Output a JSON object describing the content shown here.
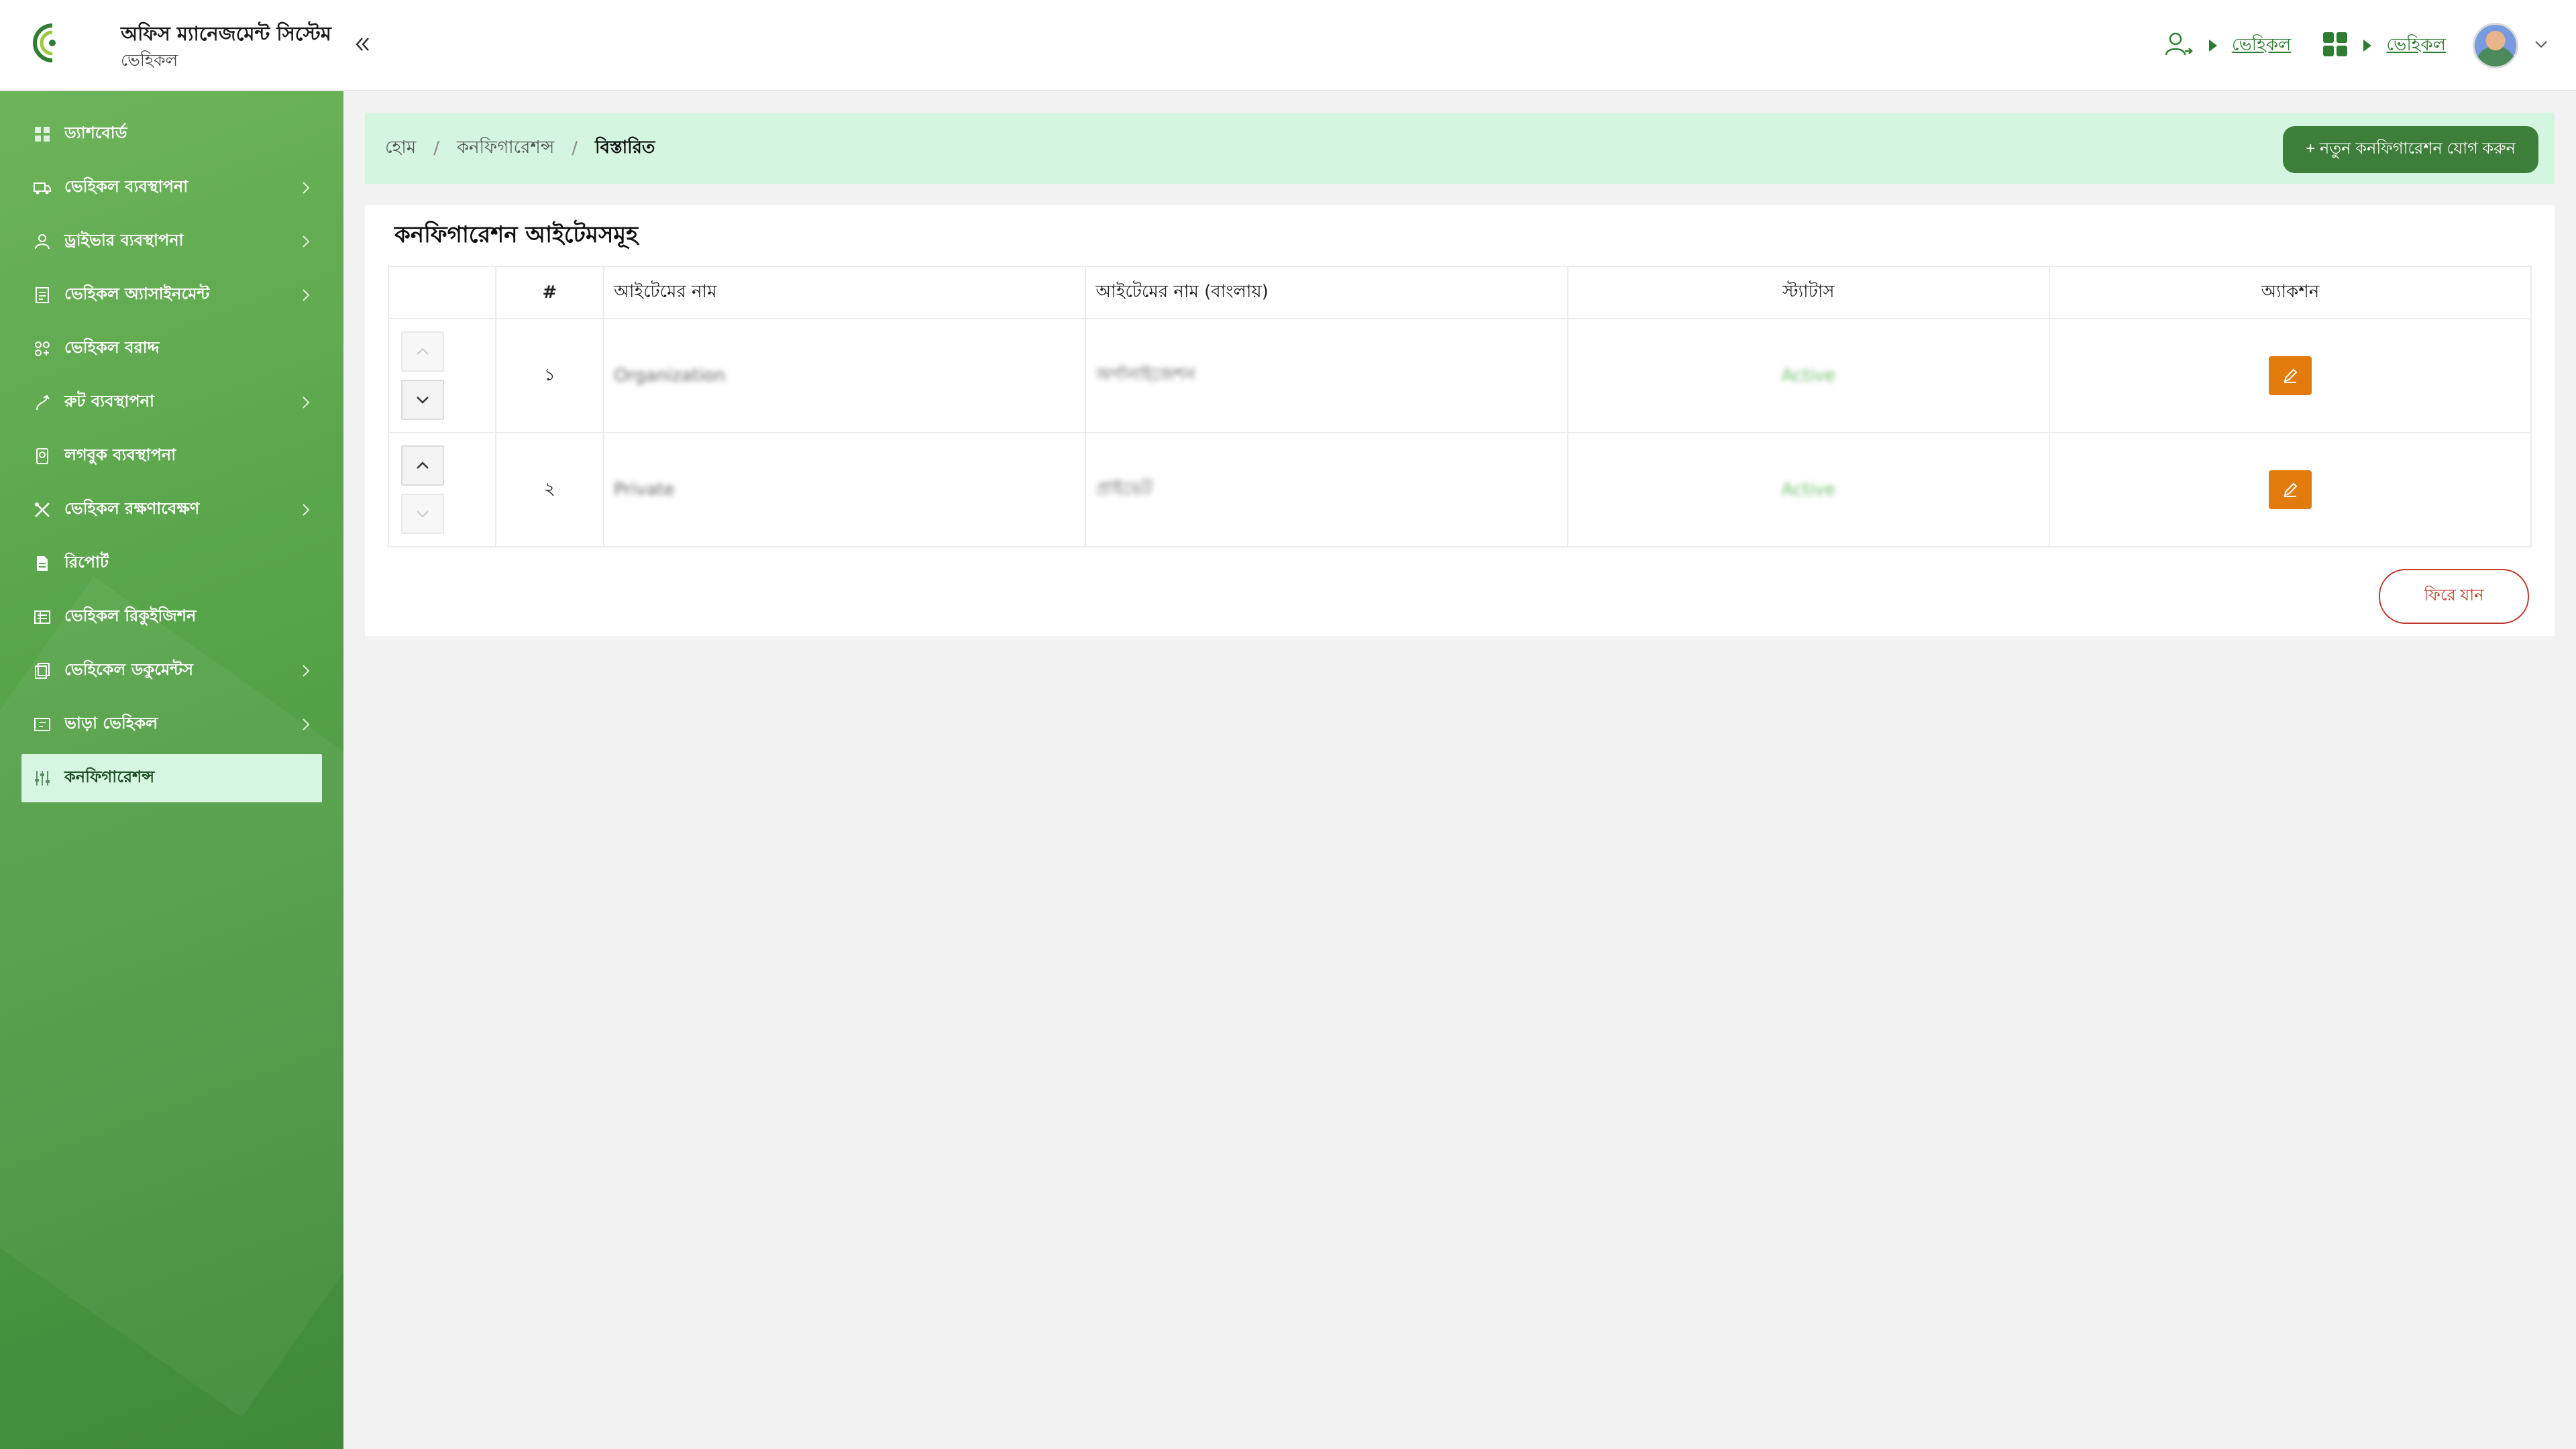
{
  "header": {
    "app_title": "অফিস ম্যানেজমেন্ট সিস্টেম",
    "app_subtitle": "ভেহিকল",
    "link1": "ভেহিকল",
    "link2": "ভেহিকল"
  },
  "sidebar": {
    "items": [
      {
        "label": "ড্যাশবোর্ড",
        "icon": "dashboard-icon"
      },
      {
        "label": "ভেহিকল ব্যবস্থাপনা",
        "icon": "car-icon"
      },
      {
        "label": "ড্রাইভার ব্যবস্থাপনা",
        "icon": "driver-icon"
      },
      {
        "label": "ভেহিকল অ্যাসাইনমেন্ট",
        "icon": "assignment-icon"
      },
      {
        "label": "ভেহিকল বরাদ্দ",
        "icon": "allocation-icon"
      },
      {
        "label": "রুট ব্যবস্থাপনা",
        "icon": "route-icon"
      },
      {
        "label": "লগবুক ব্যবস্থাপনা",
        "icon": "logbook-icon"
      },
      {
        "label": "ভেহিকল রক্ষণাবেক্ষণ",
        "icon": "wrench-icon"
      },
      {
        "label": "রিপোর্ট",
        "icon": "report-icon"
      },
      {
        "label": "ভেহিকল রিকুইজিশন",
        "icon": "requisition-icon"
      },
      {
        "label": "ভেহিকেল ডকুমেন্টস",
        "icon": "documents-icon"
      },
      {
        "label": "ভাড়া ভেহিকল",
        "icon": "rent-icon"
      },
      {
        "label": "কনফিগারেশন্স",
        "icon": "config-icon"
      }
    ]
  },
  "breadcrumb": {
    "home": "হোম",
    "configurations": "কনফিগারেশন্স",
    "current": "বিস্তারিত",
    "add_button": "+ নতুন কনফিগারেশন যোগ করুন"
  },
  "card": {
    "title": "কনফিগারেশন আইটেমসমূহ",
    "columns": [
      "#",
      "আইটেমের নাম",
      "আইটেমের নাম (বাংলায়)",
      "স্ট্যাটাস",
      "অ্যাকশন"
    ],
    "rows": [
      {
        "num": "১",
        "name": "Organization",
        "name_bn": "অর্গানাইজেশন",
        "status": "Active"
      },
      {
        "num": "২",
        "name": "Private",
        "name_bn": "প্রাইভেট",
        "status": "Active"
      }
    ],
    "back_button": "ফিরে যান"
  },
  "colors": {
    "sidebar_green": "#58a44a",
    "accent_green": "#3d7f3a",
    "crumb_bg": "#d4f5df",
    "edit_orange": "#e37b0c",
    "back_red": "#c0392b"
  }
}
